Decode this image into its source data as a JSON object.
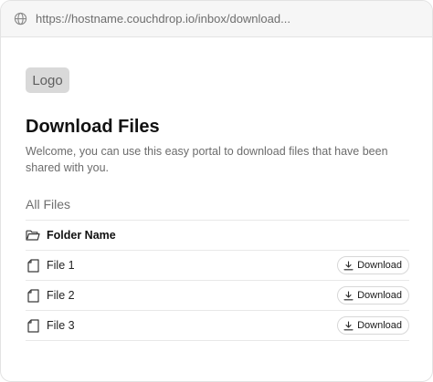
{
  "browser": {
    "url": "https://hostname.couchdrop.io/inbox/download..."
  },
  "header": {
    "logo_text": "Logo",
    "title": "Download Files",
    "subtitle": "Welcome, you can use this easy portal to download files that have been shared with you."
  },
  "files": {
    "section_label": "All Files",
    "folder": {
      "label": "Folder Name",
      "icon": "folder-icon"
    },
    "items": [
      {
        "label": "File 1",
        "icon": "file-icon",
        "button_label": "Download",
        "button_icon": "download-icon"
      },
      {
        "label": "File 2",
        "icon": "file-icon",
        "button_label": "Download",
        "button_icon": "download-icon"
      },
      {
        "label": "File 3",
        "icon": "file-icon",
        "button_label": "Download",
        "button_icon": "download-icon"
      }
    ]
  }
}
